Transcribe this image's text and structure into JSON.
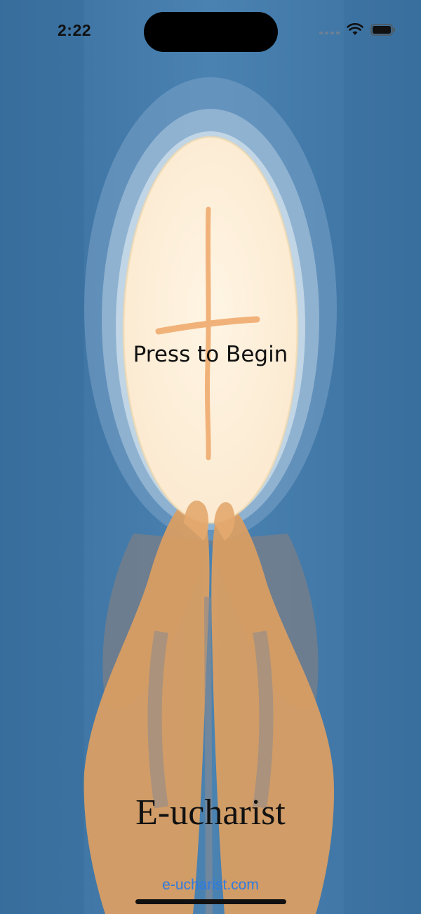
{
  "status_bar": {
    "time": "2:22"
  },
  "main": {
    "begin_label": "Press to Begin",
    "app_title": "E-ucharist",
    "link_text": "e-ucharist.com"
  },
  "colors": {
    "background": "#3f77a6",
    "host": "#fdf1dc",
    "hands": "#d99e63",
    "link": "#2f7be0"
  },
  "icons": [
    "cellular-icon",
    "wifi-icon",
    "battery-icon",
    "cross-icon"
  ]
}
